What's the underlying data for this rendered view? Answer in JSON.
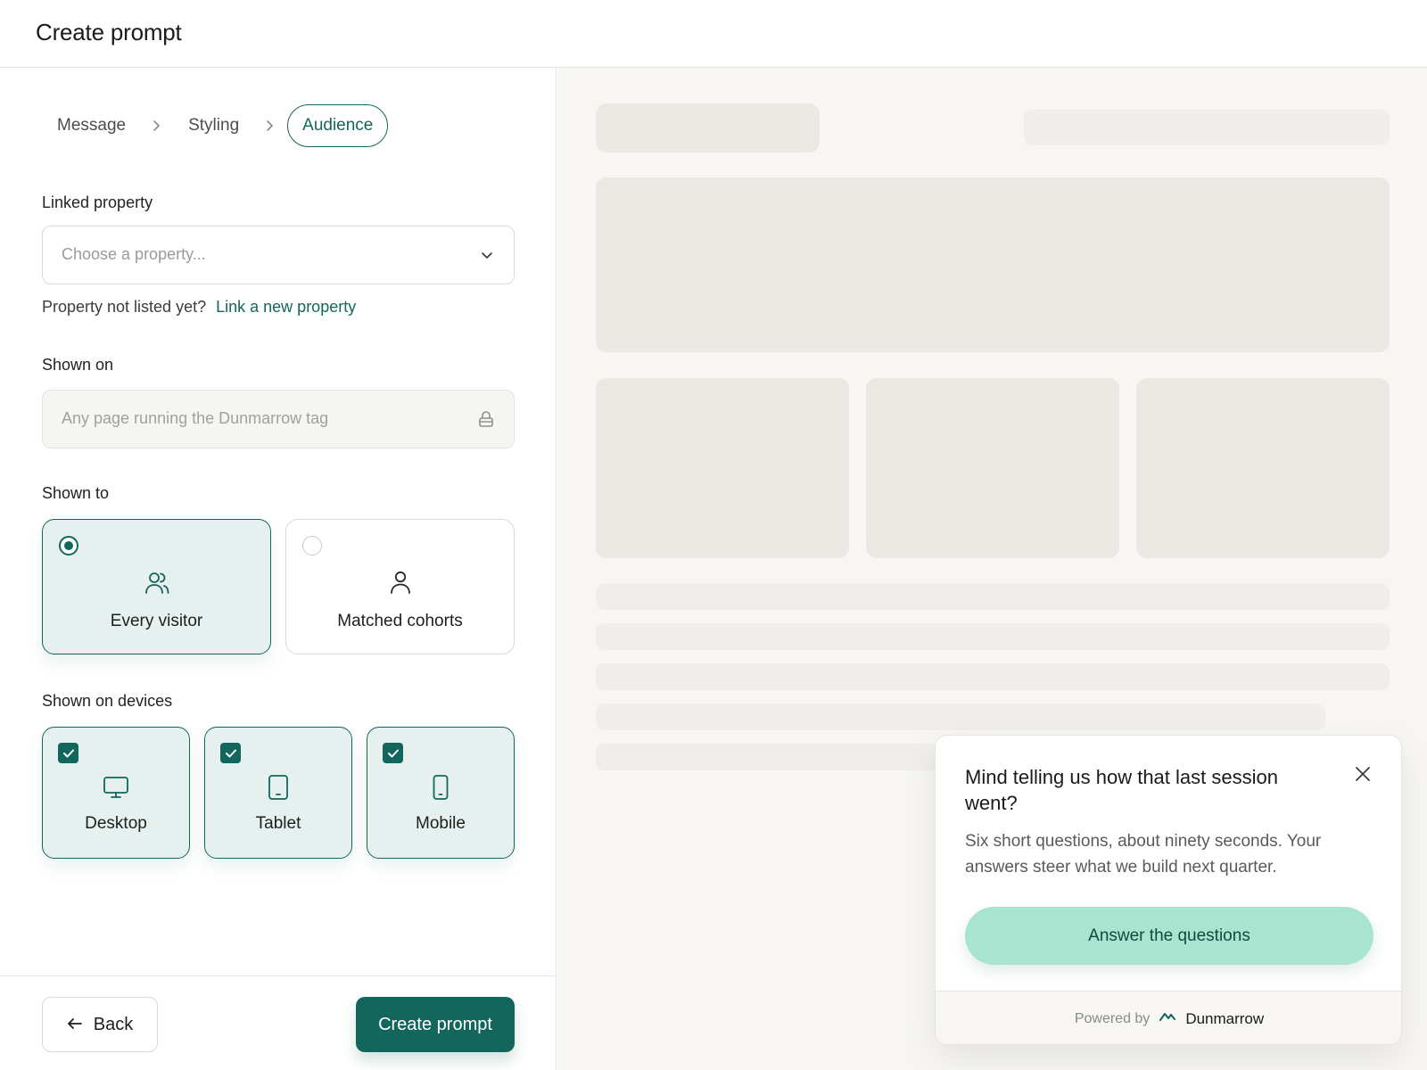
{
  "header": {
    "title": "Create prompt"
  },
  "steps": [
    {
      "label": "Message"
    },
    {
      "label": "Styling"
    },
    {
      "label": "Audience",
      "active": true
    }
  ],
  "linked_property": {
    "label": "Linked property",
    "placeholder": "Choose a property...",
    "helper": "Property not listed yet?",
    "helper_link": "Link a new property"
  },
  "shown_on": {
    "label": "Shown on",
    "value": "Any page running the Dunmarrow tag",
    "locked": true
  },
  "shown_to": {
    "label": "Shown to",
    "options": [
      {
        "label": "Every visitor",
        "icon": "users-icon",
        "selected": true
      },
      {
        "label": "Matched cohorts",
        "icon": "user-icon",
        "selected": false
      }
    ]
  },
  "devices": {
    "label": "Shown on devices",
    "options": [
      {
        "label": "Desktop",
        "icon": "desktop-icon",
        "checked": true
      },
      {
        "label": "Tablet",
        "icon": "tablet-icon",
        "checked": true
      },
      {
        "label": "Mobile",
        "icon": "mobile-icon",
        "checked": true
      }
    ]
  },
  "footer": {
    "back_label": "Back",
    "create_label": "Create prompt"
  },
  "popup": {
    "title": "Mind telling us how that last session went?",
    "body": "Six short questions, about ninety seconds. Your answers steer what we build next quarter.",
    "cta": "Answer the questions",
    "powered_by": "Powered by",
    "brand": "Dunmarrow"
  },
  "colors": {
    "accent": "#13665b",
    "selected_bg": "#e6f1ef",
    "cta_bg": "#a7e5d0",
    "preview_bg": "#f7f6f2",
    "skeleton": "#e9e8e3"
  }
}
